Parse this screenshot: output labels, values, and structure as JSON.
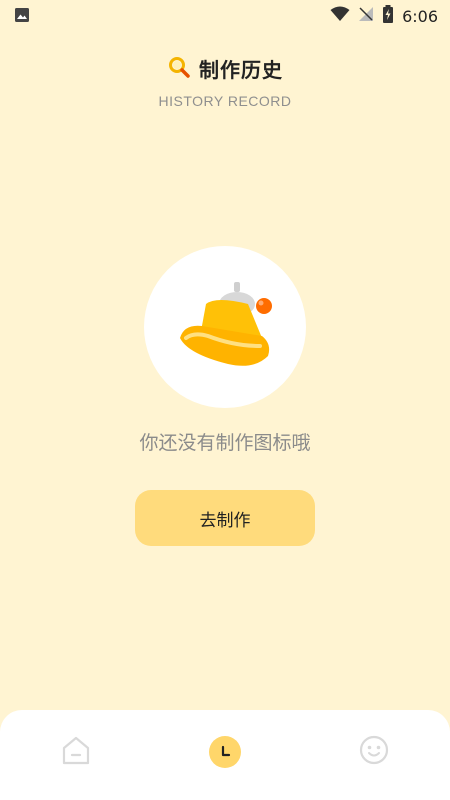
{
  "status_bar": {
    "time": "6:06",
    "icons": [
      "image-icon",
      "wifi-icon",
      "no-signal-icon",
      "battery-charging-icon"
    ]
  },
  "header": {
    "icon": "search-icon",
    "title": "制作历史",
    "subtitle": "HISTORY RECORD"
  },
  "empty_state": {
    "illustration": "bell-illustration",
    "message": "你还没有制作图标哦",
    "button_label": "去制作"
  },
  "bottom_nav": {
    "items": [
      {
        "icon": "home-icon",
        "active": false
      },
      {
        "icon": "clock-icon",
        "active": true
      },
      {
        "icon": "smiley-icon",
        "active": false
      }
    ]
  },
  "colors": {
    "background": "#FFF4D2",
    "accent": "#FFDB7C",
    "active_nav": "#FFD66A"
  }
}
